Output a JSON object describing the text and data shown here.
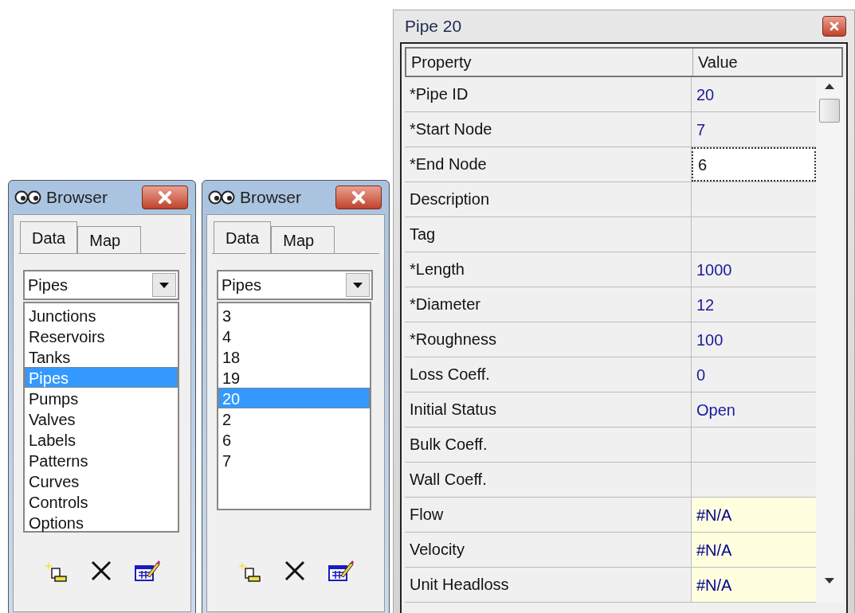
{
  "browsers": [
    {
      "title": "Browser",
      "tabs": [
        {
          "label": "Data",
          "selected": true
        },
        {
          "label": "Map",
          "selected": false
        }
      ],
      "dropdown": {
        "value": "Pipes"
      },
      "items": [
        {
          "label": "Junctions",
          "selected": false
        },
        {
          "label": "Reservoirs",
          "selected": false
        },
        {
          "label": "Tanks",
          "selected": false
        },
        {
          "label": "Pipes",
          "selected": true
        },
        {
          "label": "Pumps",
          "selected": false
        },
        {
          "label": "Valves",
          "selected": false
        },
        {
          "label": "Labels",
          "selected": false
        },
        {
          "label": "Patterns",
          "selected": false
        },
        {
          "label": "Curves",
          "selected": false
        },
        {
          "label": "Controls",
          "selected": false
        },
        {
          "label": "Options",
          "selected": false
        }
      ]
    },
    {
      "title": "Browser",
      "tabs": [
        {
          "label": "Data",
          "selected": true
        },
        {
          "label": "Map",
          "selected": false
        }
      ],
      "dropdown": {
        "value": "Pipes"
      },
      "items": [
        {
          "label": "3",
          "selected": false
        },
        {
          "label": "4",
          "selected": false
        },
        {
          "label": "18",
          "selected": false
        },
        {
          "label": "19",
          "selected": false
        },
        {
          "label": "20",
          "selected": true
        },
        {
          "label": "2",
          "selected": false
        },
        {
          "label": "6",
          "selected": false
        },
        {
          "label": "7",
          "selected": false
        }
      ]
    }
  ],
  "property_window": {
    "title": "Pipe 20",
    "columns": [
      "Property",
      "Value"
    ],
    "rows": [
      {
        "property": "*Pipe ID",
        "value": "20",
        "kind": "input"
      },
      {
        "property": "*Start Node",
        "value": "7",
        "kind": "input"
      },
      {
        "property": "*End Node",
        "value": "6",
        "kind": "editing"
      },
      {
        "property": "Description",
        "kind": "input"
      },
      {
        "property": "Tag",
        "kind": "input"
      },
      {
        "property": "*Length",
        "value": "1000",
        "kind": "input"
      },
      {
        "property": "*Diameter",
        "value": "12",
        "kind": "input"
      },
      {
        "property": "*Roughness",
        "value": "100",
        "kind": "input"
      },
      {
        "property": "Loss Coeff.",
        "value": "0",
        "kind": "input"
      },
      {
        "property": "Initial Status",
        "value": "Open",
        "kind": "input"
      },
      {
        "property": "Bulk Coeff.",
        "kind": "input"
      },
      {
        "property": "Wall Coeff.",
        "kind": "input"
      },
      {
        "property": "Flow",
        "value": "#N/A",
        "kind": "result"
      },
      {
        "property": "Velocity",
        "value": "#N/A",
        "kind": "result"
      },
      {
        "property": "Unit Headloss",
        "value": "#N/A",
        "kind": "result"
      }
    ]
  }
}
